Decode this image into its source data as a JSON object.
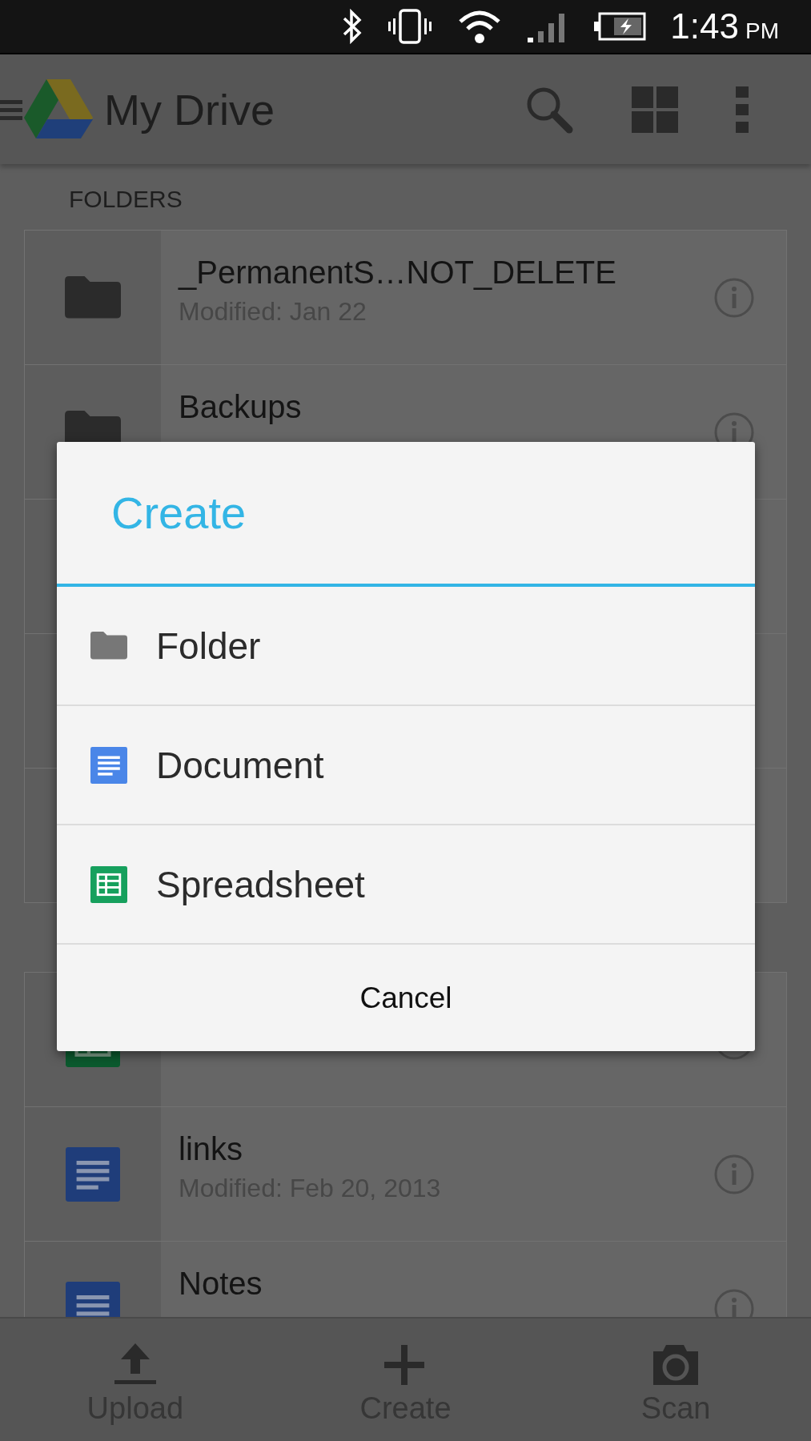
{
  "status_bar": {
    "time": "1:43",
    "period": "PM"
  },
  "app_bar": {
    "title": "My Drive"
  },
  "sections": [
    {
      "heading": "FOLDERS",
      "rows": [
        {
          "kind": "folder",
          "title": "_PermanentS…NOT_DELETE",
          "subtitle": "Modified: Jan 22"
        },
        {
          "kind": "folder",
          "title": "Backups"
        }
      ]
    },
    {
      "rows": [
        {
          "kind": "spreadsheet"
        },
        {
          "kind": "document",
          "title": "links",
          "subtitle": "Modified: Feb 20, 2013"
        },
        {
          "kind": "document",
          "title": "Notes"
        }
      ]
    }
  ],
  "dialog": {
    "title": "Create",
    "options": [
      {
        "kind": "folder",
        "label": "Folder"
      },
      {
        "kind": "document",
        "label": "Document"
      },
      {
        "kind": "spreadsheet",
        "label": "Spreadsheet"
      }
    ],
    "cancel": "Cancel"
  },
  "bottom_bar": [
    {
      "kind": "upload",
      "label": "Upload"
    },
    {
      "kind": "create",
      "label": "Create"
    },
    {
      "kind": "scan",
      "label": "Scan"
    }
  ]
}
